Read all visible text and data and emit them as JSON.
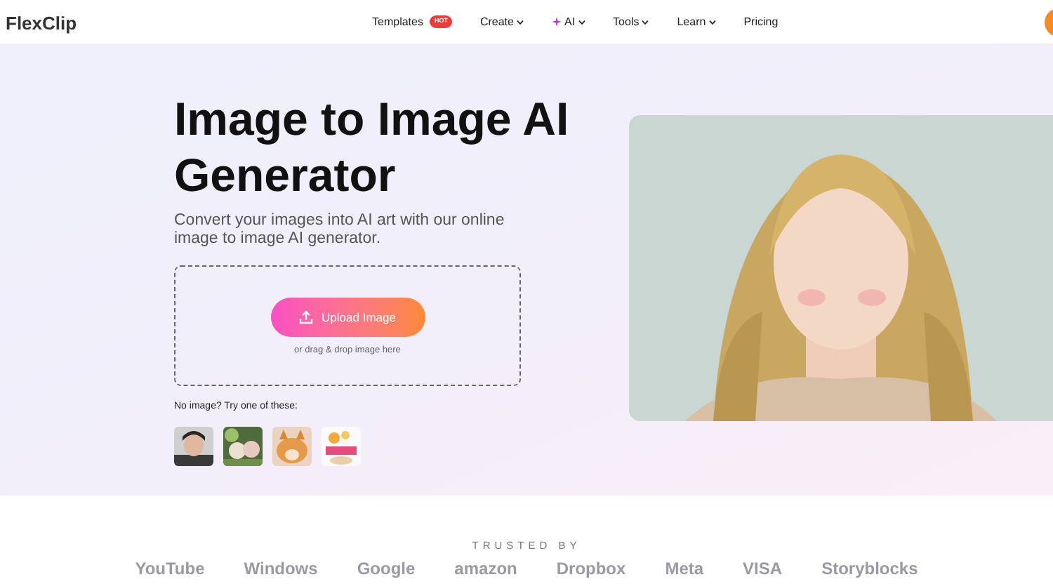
{
  "header": {
    "logo": "FlexClip",
    "nav": [
      {
        "label": "Templates",
        "badge": "HOT",
        "dropdown": false,
        "sparkle": false
      },
      {
        "label": "Create",
        "dropdown": true,
        "sparkle": false
      },
      {
        "label": "AI",
        "dropdown": true,
        "sparkle": true
      },
      {
        "label": "Tools",
        "dropdown": true,
        "sparkle": false
      },
      {
        "label": "Learn",
        "dropdown": true,
        "sparkle": false
      },
      {
        "label": "Pricing",
        "dropdown": false,
        "sparkle": false
      }
    ]
  },
  "hero": {
    "title": "Image to Image AI Generator",
    "description": "Convert your images into AI art with our online image to image AI generator.",
    "upload": {
      "button": "Upload Image",
      "hint": "or drag & drop image here"
    },
    "samples_label": "No image? Try one of these:"
  },
  "trusted": {
    "label": "TRUSTED BY",
    "logos": [
      "YouTube",
      "Windows",
      "Google",
      "amazon",
      "Dropbox",
      "Meta",
      "VISA",
      "Storyblocks"
    ]
  }
}
